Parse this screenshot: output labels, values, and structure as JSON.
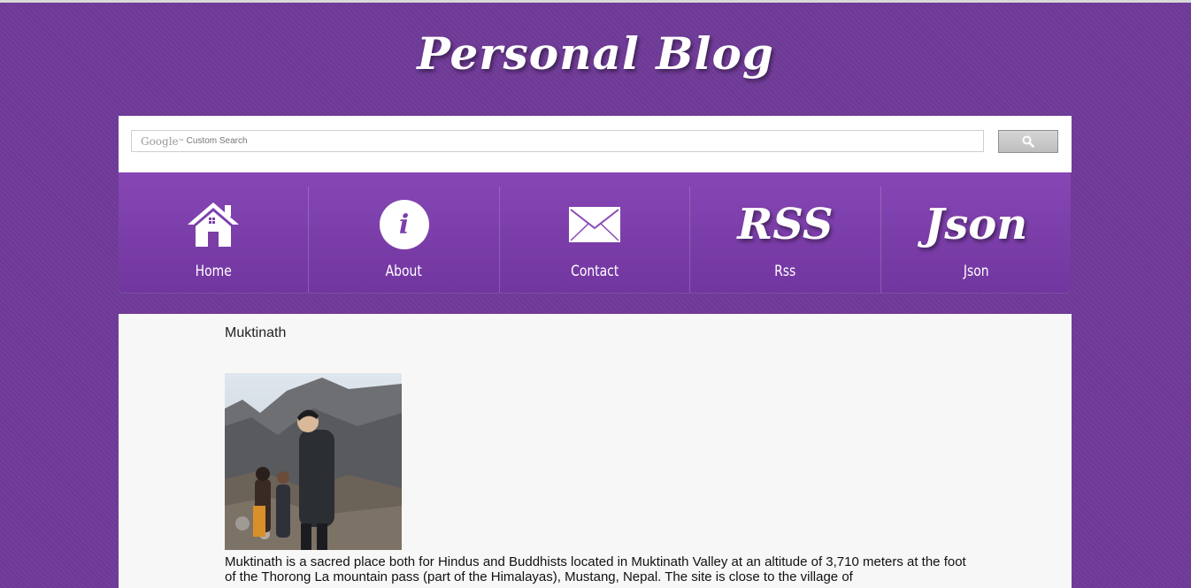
{
  "site": {
    "title": "Personal Blog"
  },
  "search": {
    "google_label": "Google",
    "google_tm": "™",
    "custom_label": "Custom Search",
    "button_icon": "search-icon"
  },
  "nav": {
    "items": [
      {
        "label": "Home",
        "icon": "house-icon"
      },
      {
        "label": "About",
        "icon": "info-icon",
        "glyph": "i"
      },
      {
        "label": "Contact",
        "icon": "envelope-icon"
      },
      {
        "label": "Rss",
        "icon": "rss-icon",
        "glyph": "RSS"
      },
      {
        "label": "Json",
        "icon": "json-icon",
        "glyph": "Json"
      }
    ]
  },
  "post": {
    "title": "Muktinath",
    "body": "Muktinath is a sacred place both for Hindus and Buddhists located in Muktinath Valley at an altitude of 3,710 meters at the foot of the Thorong La mountain pass (part of the Himalayas), Mustang, Nepal. The site is close to the village of"
  },
  "colors": {
    "background": "#6f3a98",
    "nav_top": "#8647b4",
    "nav_bottom": "#7236a0",
    "content_bg": "#f7f7f7"
  }
}
